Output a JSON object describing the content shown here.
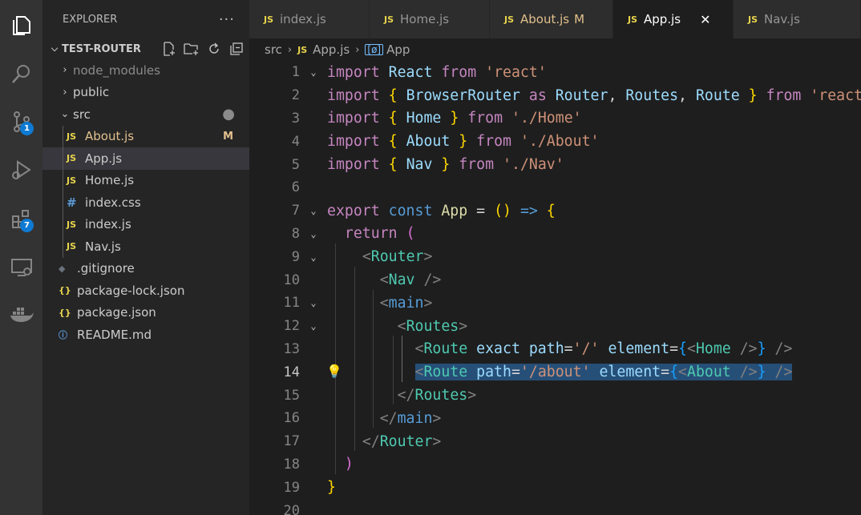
{
  "explorer": {
    "title": "EXPLORER",
    "more": "···",
    "project": "TEST-ROUTER",
    "items": [
      {
        "label": "node_modules",
        "type": "folder",
        "expanded": false
      },
      {
        "label": "public",
        "type": "folder",
        "expanded": false
      },
      {
        "label": "src",
        "type": "folder",
        "expanded": true
      },
      {
        "label": "About.js",
        "type": "js",
        "status": "M"
      },
      {
        "label": "App.js",
        "type": "js"
      },
      {
        "label": "Home.js",
        "type": "js"
      },
      {
        "label": "index.css",
        "type": "css"
      },
      {
        "label": "index.js",
        "type": "js"
      },
      {
        "label": "Nav.js",
        "type": "js"
      },
      {
        "label": ".gitignore",
        "type": "git"
      },
      {
        "label": "package-lock.json",
        "type": "json"
      },
      {
        "label": "package.json",
        "type": "json"
      },
      {
        "label": "README.md",
        "type": "info"
      }
    ]
  },
  "activity": {
    "scm_badge": "1",
    "extensions_badge": "7"
  },
  "tabs": [
    {
      "label": "index.js",
      "icon": "JS"
    },
    {
      "label": "Home.js",
      "icon": "JS"
    },
    {
      "label": "About.js",
      "icon": "JS",
      "mod": "M"
    },
    {
      "label": "App.js",
      "icon": "JS",
      "close": "✕"
    },
    {
      "label": "Nav.js",
      "icon": "JS"
    }
  ],
  "breadcrumb": {
    "folder": "src",
    "file": "App.js",
    "file_icon": "JS",
    "symbol": "App",
    "symbol_icon": "[ø]"
  },
  "editor": {
    "line_numbers": [
      "1",
      "2",
      "3",
      "4",
      "5",
      "6",
      "7",
      "8",
      "9",
      "10",
      "11",
      "12",
      "13",
      "14",
      "15",
      "16",
      "17",
      "18",
      "19",
      "20"
    ],
    "current_line": "14",
    "colors": {
      "keyword": "#c586c0",
      "string": "#ce9178",
      "tag": "#4ec9b0",
      "selection": "#264f78"
    }
  }
}
